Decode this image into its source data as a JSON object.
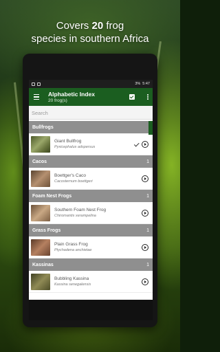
{
  "headline": {
    "line1_pre": "Covers ",
    "line1_bold": "20",
    "line1_post": " frog",
    "line2": "species in southern Africa"
  },
  "status_bar": {
    "battery": "3%",
    "time": "5:47"
  },
  "app_bar": {
    "title": "Alphabetic Index",
    "subtitle": "20 frog(s)"
  },
  "search": {
    "placeholder": "Search",
    "value": ""
  },
  "sections": [
    {
      "title": "Bullfrogs",
      "count": "",
      "items": [
        {
          "name": "Giant Bullfrog",
          "scientific": "Pyxicephalus adspersus",
          "checked": true,
          "thumb_color": "#7c8a55"
        }
      ]
    },
    {
      "title": "Cacos",
      "count": "1",
      "items": [
        {
          "name": "Boettger's Caco",
          "scientific": "Cacosternum boettgeri",
          "checked": false,
          "thumb_color": "#8a6a4a"
        }
      ]
    },
    {
      "title": "Foam Nest Frogs",
      "count": "1",
      "items": [
        {
          "name": "Southern Foam Nest Frog",
          "scientific": "Chiromantis xerampelina",
          "checked": false,
          "thumb_color": "#a08060"
        }
      ]
    },
    {
      "title": "Grass Frogs",
      "count": "1",
      "items": [
        {
          "name": "Plain Grass Frog",
          "scientific": "Ptychadena anchietae",
          "checked": false,
          "thumb_color": "#8a5a40"
        }
      ]
    },
    {
      "title": "Kassinas",
      "count": "1",
      "items": [
        {
          "name": "Bubbling Kassina",
          "scientific": "Kassina senegalensis",
          "checked": false,
          "thumb_color": "#6a6a3a"
        }
      ]
    }
  ],
  "colors": {
    "app_bar": "#1b5e20",
    "section_header": "#8f8f8f"
  }
}
